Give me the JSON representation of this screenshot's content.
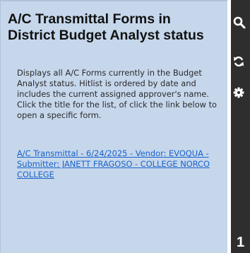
{
  "panel": {
    "title": "A/C Transmittal Forms in District Budget Analyst status",
    "description": "Displays all A/C Forms currently in the Budget Analyst status. Hitlist is ordered by date and includes the current assigned approver's name.\nClick the title for the list, of click the link below to open a specific form.",
    "items": [
      {
        "label": "A/C Transmittal - 6/24/2025 - Vendor: EVOQUA - Submitter: JANETT FRAGOSO - COLLEGE NORCO COLLEGE"
      }
    ]
  },
  "toolbar": {
    "icons": [
      "search-icon",
      "refresh-icon",
      "gear-icon"
    ],
    "count": "1"
  },
  "colors": {
    "panel_background": "#c6d7ec",
    "toolbar_background": "#2e2e2e",
    "link": "#1a63c9",
    "toolbar_icon": "#ffffff"
  }
}
